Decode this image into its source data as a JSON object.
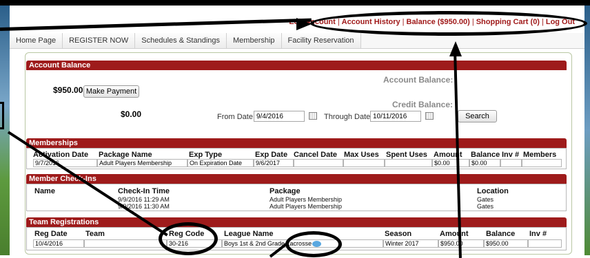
{
  "top_links": [
    "Edit Account",
    "Account History",
    "Balance ($950.00)",
    "Shopping Cart (0)",
    "Log Out"
  ],
  "nav": [
    "Home Page",
    "REGISTER NOW",
    "Schedules & Standings",
    "Membership",
    "Facility Reservation"
  ],
  "account_balance": {
    "header": "Account Balance",
    "account_balance_label": "Account Balance:",
    "account_balance_value": "$950.00",
    "make_payment": "Make Payment",
    "credit_balance_label": "Credit Balance:",
    "credit_balance_value": "$0.00",
    "from_label": "From Date:",
    "from_value": "9/4/2016",
    "through_label": "Through Date:",
    "through_value": "10/11/2016",
    "search": "Search"
  },
  "memberships": {
    "header": "Memberships",
    "columns": [
      "Activation Date",
      "Package Name",
      "Exp Type",
      "Exp Date",
      "Cancel Date",
      "Max Uses",
      "Spent Uses",
      "Amount",
      "Balance",
      "Inv #",
      "Members"
    ],
    "row": [
      "9/7/2016",
      "Adult Players Membership",
      "On Expiration Date",
      "9/6/2017",
      "",
      "",
      "",
      "$0.00",
      "$0.00",
      "",
      ""
    ]
  },
  "checkins": {
    "header": "Member Check-Ins",
    "columns": [
      "Name",
      "Check-In Time",
      "Package",
      "Location"
    ],
    "rows": [
      [
        "",
        "9/9/2016 11:29 AM",
        "Adult Players Membership",
        "Gates"
      ],
      [
        "",
        "9/9/2016 11:30 AM",
        "Adult Players Membership",
        "Gates"
      ]
    ]
  },
  "team_registrations": {
    "header": "Team Registrations",
    "columns": [
      "Reg Date",
      "Team",
      "Reg Code",
      "League Name",
      "Season",
      "Amount",
      "Balance",
      "Inv #"
    ],
    "row": [
      "10/4/2016",
      "",
      "30-216",
      "Boys 1st & 2nd Grade Lacrosse",
      "Winter 2017",
      "$950.00",
      "$950.00",
      ""
    ]
  },
  "icons": {
    "calendar": "calendar-icon",
    "comment": "comment-bubble-icon"
  }
}
